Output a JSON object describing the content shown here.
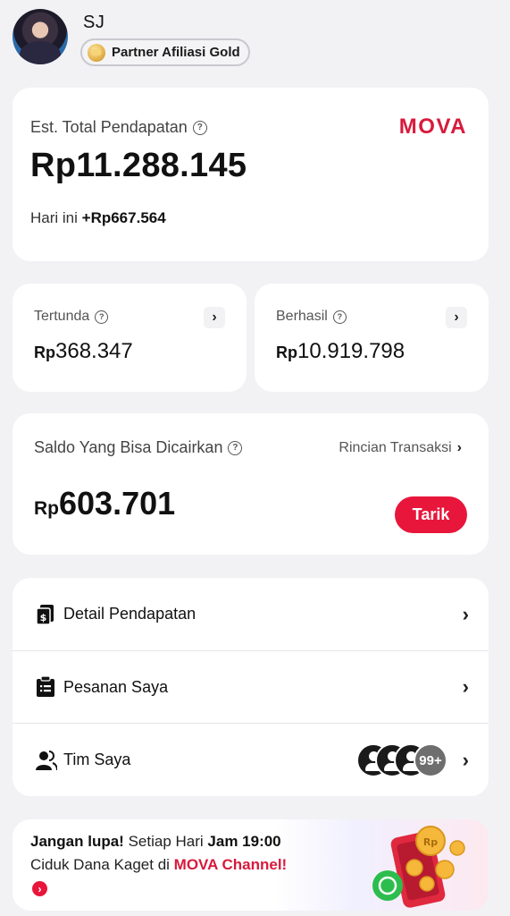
{
  "profile": {
    "name": "SJ",
    "badge_label": "Partner Afiliasi Gold"
  },
  "total": {
    "label": "Est. Total Pendapatan",
    "help_icon": "?",
    "brand": "MOVA",
    "amount": "Rp11.288.145",
    "today_label": "Hari ini",
    "today_value": "+Rp667.564"
  },
  "pending": {
    "label": "Tertunda",
    "currency": "Rp",
    "amount": "368.347"
  },
  "success": {
    "label": "Berhasil",
    "currency": "Rp",
    "amount": "10.919.798"
  },
  "withdraw": {
    "label": "Saldo Yang Bisa Dicairkan",
    "link_label": "Rincian Transaksi",
    "currency": "Rp",
    "amount": "603.701",
    "button_label": "Tarik"
  },
  "menu": {
    "items": [
      {
        "label": "Detail Pendapatan",
        "icon": "money-doc-icon"
      },
      {
        "label": "Pesanan Saya",
        "icon": "clipboard-icon"
      },
      {
        "label": "Tim Saya",
        "icon": "team-icon"
      }
    ],
    "team_count": "99+"
  },
  "promo": {
    "bold1": "Jangan lupa!",
    "text1": " Setiap Hari ",
    "bold2": "Jam 19:00",
    "text2": " Ciduk Dana Kaget di ",
    "red": "MOVA Channel!",
    "arrow": "›"
  },
  "colors": {
    "accent": "#e8163b",
    "brand": "#d81a3c",
    "background": "#f2f2f4"
  }
}
